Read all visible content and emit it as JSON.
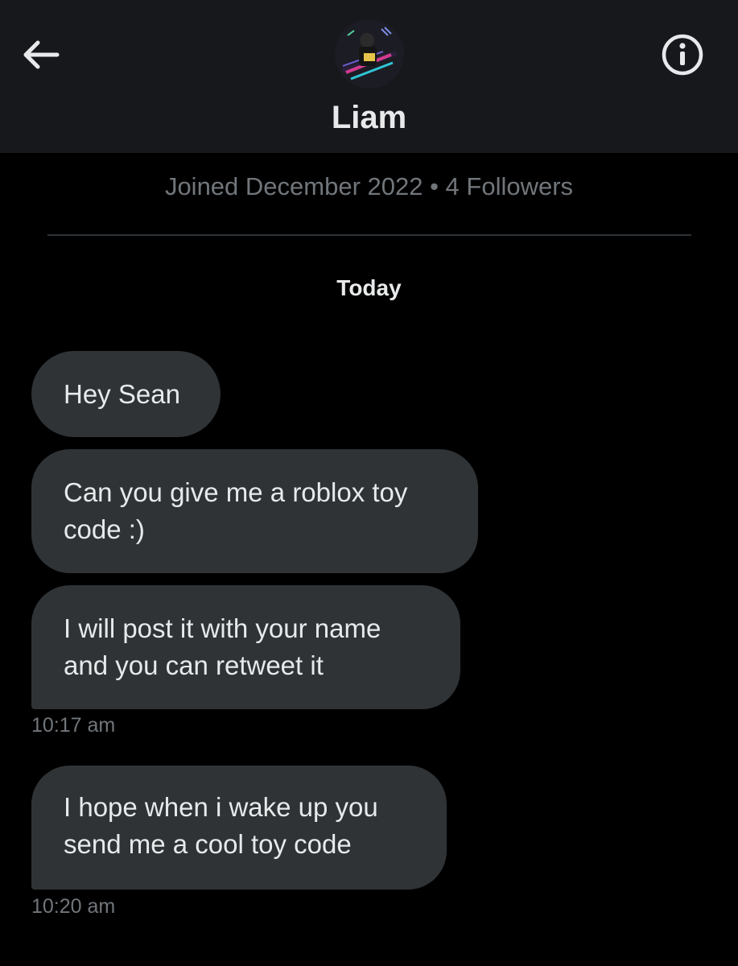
{
  "header": {
    "contact_name": "Liam",
    "back_icon": "arrow-left-icon",
    "info_icon": "info-icon"
  },
  "profile": {
    "meta": "Joined December 2022 • 4 Followers"
  },
  "conversation": {
    "day_label": "Today",
    "messages": [
      {
        "text": "Hey Sean"
      },
      {
        "text": "Can you give me a roblox toy code :)"
      },
      {
        "text": "I will post it with your name and you can retweet it",
        "time": "10:17 am"
      },
      {
        "text": "I hope when i wake up you send me a cool toy code",
        "time": "10:20 am"
      }
    ]
  },
  "colors": {
    "background": "#000000",
    "header": "#16181c",
    "bubble": "#2f3336",
    "text": "#e7e9ea",
    "muted": "#71767b"
  }
}
